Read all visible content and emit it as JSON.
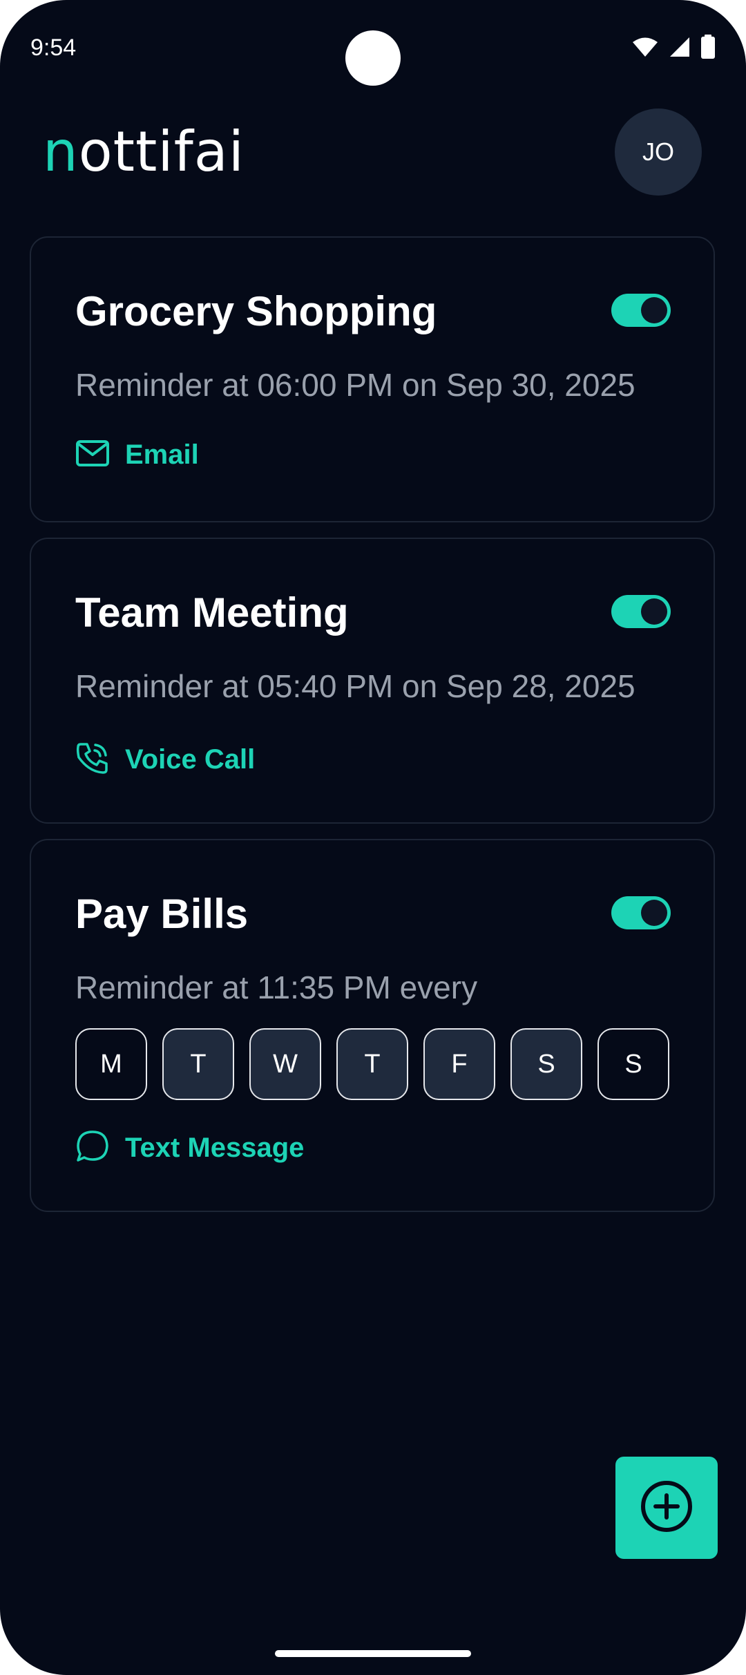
{
  "status_bar": {
    "time": "9:54"
  },
  "header": {
    "logo_first": "n",
    "logo_rest": "ottifai",
    "avatar_initials": "JO"
  },
  "reminders": [
    {
      "title": "Grocery Shopping",
      "schedule": "Reminder at 06:00 PM on Sep 30, 2025",
      "channel": "Email",
      "channel_icon": "mail-icon",
      "enabled": true
    },
    {
      "title": "Team Meeting",
      "schedule": "Reminder at 05:40 PM on Sep 28, 2025",
      "channel": "Voice Call",
      "channel_icon": "phone-call-icon",
      "enabled": true
    },
    {
      "title": "Pay Bills",
      "schedule": "Reminder at 11:35 PM every",
      "channel": "Text Message",
      "channel_icon": "message-bubble-icon",
      "enabled": true,
      "days": [
        {
          "label": "M",
          "selected": false
        },
        {
          "label": "T",
          "selected": true
        },
        {
          "label": "W",
          "selected": true
        },
        {
          "label": "T",
          "selected": true
        },
        {
          "label": "F",
          "selected": true
        },
        {
          "label": "S",
          "selected": true
        },
        {
          "label": "S",
          "selected": false
        }
      ]
    }
  ],
  "fab_icon": "plus-circle-icon",
  "colors": {
    "accent": "#1dd3b5",
    "background": "#050a18",
    "card_border": "#1d2535",
    "muted_text": "#9aa1ad",
    "selected_day": "#1f2a3d"
  }
}
